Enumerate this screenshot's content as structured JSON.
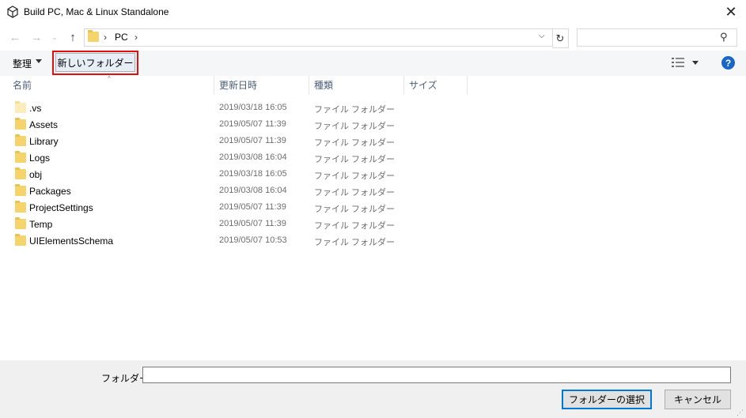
{
  "window": {
    "title": "Build PC, Mac & Linux Standalone"
  },
  "nav": {
    "path_root": "PC"
  },
  "search": {
    "placeholder": ""
  },
  "toolbar": {
    "organize_label": "整理",
    "new_folder_label": "新しいフォルダー"
  },
  "columns": {
    "name": "名前",
    "date": "更新日時",
    "type": "種類",
    "size": "サイズ"
  },
  "files": [
    {
      "name": ".vs",
      "date": "2019/03/18 16:05",
      "type": "ファイル フォルダー"
    },
    {
      "name": "Assets",
      "date": "2019/05/07 11:39",
      "type": "ファイル フォルダー"
    },
    {
      "name": "Library",
      "date": "2019/05/07 11:39",
      "type": "ファイル フォルダー"
    },
    {
      "name": "Logs",
      "date": "2019/03/08 16:04",
      "type": "ファイル フォルダー"
    },
    {
      "name": "obj",
      "date": "2019/03/18 16:05",
      "type": "ファイル フォルダー"
    },
    {
      "name": "Packages",
      "date": "2019/03/08 16:04",
      "type": "ファイル フォルダー"
    },
    {
      "name": "ProjectSettings",
      "date": "2019/05/07 11:39",
      "type": "ファイル フォルダー"
    },
    {
      "name": "Temp",
      "date": "2019/05/07 11:39",
      "type": "ファイル フォルダー"
    },
    {
      "name": "UIElementsSchema",
      "date": "2019/05/07 10:53",
      "type": "ファイル フォルダー"
    }
  ],
  "footer": {
    "folder_label": "フォルダー:",
    "folder_value": "",
    "select_label": "フォルダーの選択",
    "cancel_label": "キャンセル"
  },
  "colors": {
    "highlight": "#e01010",
    "accent": "#0078d7",
    "folder": "#f4d46b"
  }
}
